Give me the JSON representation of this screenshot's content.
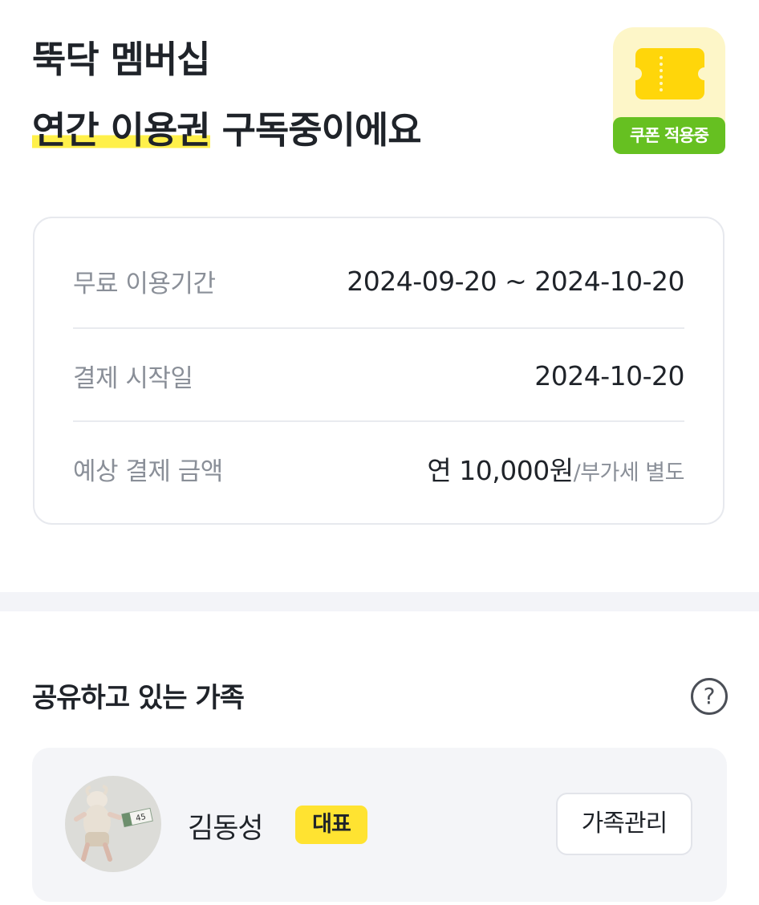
{
  "header": {
    "title_line1": "뚝닥 멤버십",
    "plan_highlight": "연간 이용권",
    "status_text": " 구독중이에요"
  },
  "coupon": {
    "badge_label": "쿠폰 적용중",
    "icon": "ticket-icon",
    "colors": {
      "ticket": "#ffd60a",
      "badge": "#66c021",
      "card": "#fdf6c8"
    }
  },
  "subscription": {
    "rows": [
      {
        "label": "무료 이용기간",
        "value": "2024-09-20 ~ 2024-10-20"
      },
      {
        "label": "결제 시작일",
        "value": "2024-10-20"
      },
      {
        "label": "예상 결제 금액",
        "value": "연 10,000원",
        "suffix": "/부가세 별도"
      }
    ]
  },
  "family": {
    "section_title": "공유하고 있는 가족",
    "help_icon": "help-icon",
    "help_symbol": "?",
    "members": [
      {
        "name": "김동성",
        "badge": "대표",
        "avatar": "baby-photo-avatar"
      }
    ],
    "manage_label": "가족관리"
  }
}
